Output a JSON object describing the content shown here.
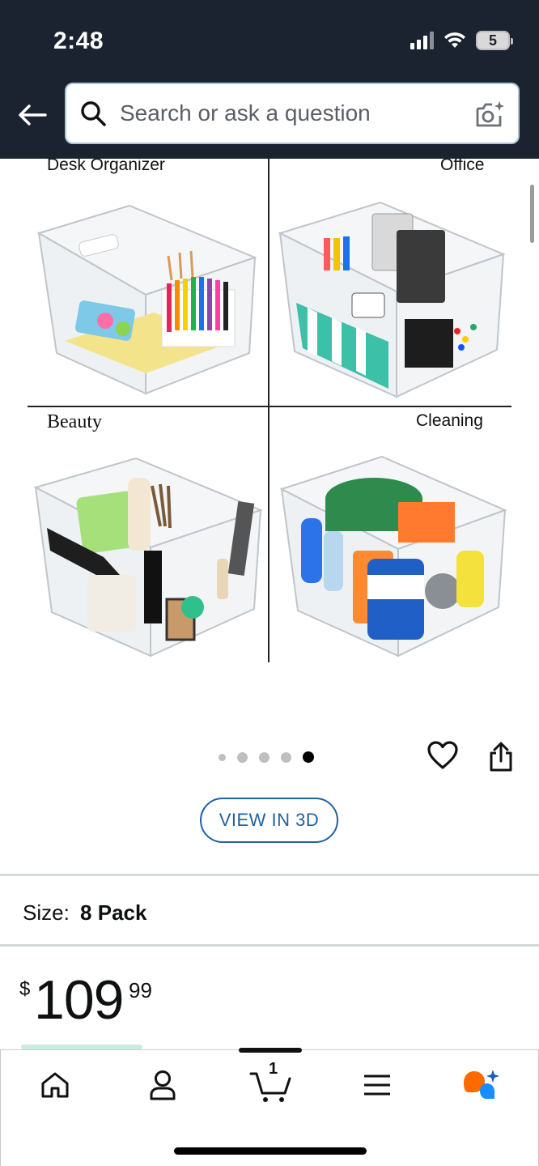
{
  "status_bar": {
    "time": "2:48",
    "battery": "5"
  },
  "search": {
    "placeholder": "Search or ask a question"
  },
  "product_image": {
    "labels": {
      "top_left": "Desk Organizer",
      "top_right": "Office",
      "bottom_left": "Beauty",
      "bottom_right": "Cleaning"
    },
    "carousel_total": 5,
    "carousel_active": 5
  },
  "actions": {
    "view_3d_label": "VIEW IN 3D"
  },
  "size": {
    "label": "Size:",
    "value": "8 Pack"
  },
  "price": {
    "symbol": "$",
    "whole": "109",
    "fraction": "99"
  },
  "bottom_nav": {
    "items": [
      "home-icon",
      "account-icon",
      "cart-icon",
      "menu-icon",
      "rufus-icon"
    ],
    "cart_count": "1"
  },
  "colors": {
    "header": "#1b2230",
    "link_blue": "#2162a1",
    "rufus_orange": "#ff6a00",
    "rufus_blue": "#1a8cff"
  }
}
